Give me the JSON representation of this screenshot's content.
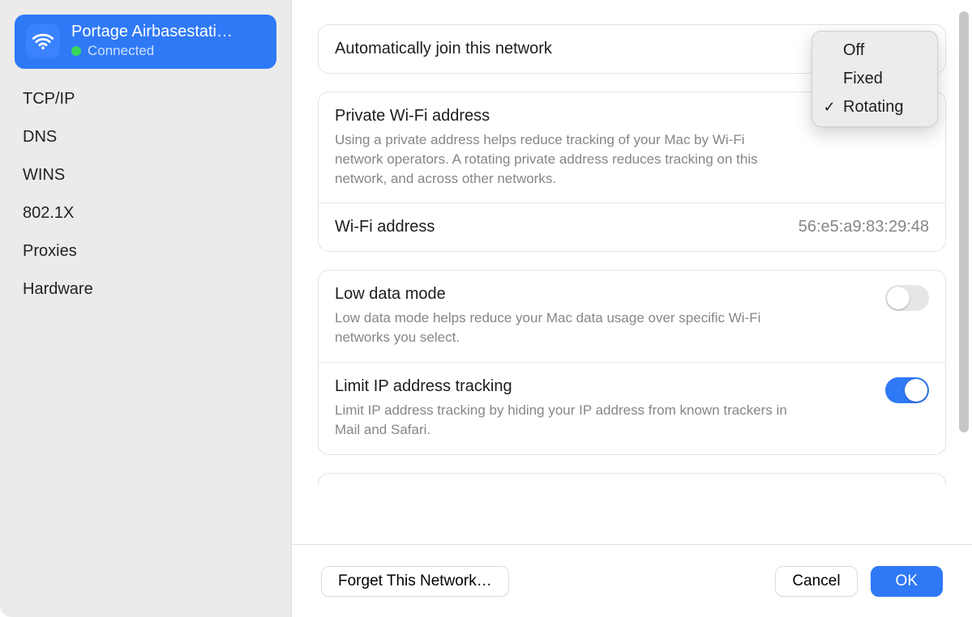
{
  "sidebar": {
    "network": {
      "name": "Portage Airbasestati…",
      "status_label": "Connected"
    },
    "items": [
      {
        "label": "TCP/IP"
      },
      {
        "label": "DNS"
      },
      {
        "label": "WINS"
      },
      {
        "label": "802.1X"
      },
      {
        "label": "Proxies"
      },
      {
        "label": "Hardware"
      }
    ]
  },
  "settings": {
    "auto_join": {
      "title": "Automatically join this network"
    },
    "private_address": {
      "title": "Private Wi-Fi address",
      "desc": "Using a private address helps reduce tracking of your Mac by Wi-Fi network operators. A rotating private address reduces tracking on this network, and across other networks."
    },
    "wifi_address": {
      "title": "Wi-Fi address",
      "value": "56:e5:a9:83:29:48"
    },
    "low_data": {
      "title": "Low data mode",
      "desc": "Low data mode helps reduce your Mac data usage over specific Wi-Fi networks you select.",
      "enabled": false
    },
    "limit_ip": {
      "title": "Limit IP address tracking",
      "desc": "Limit IP address tracking by hiding your IP address from known trackers in Mail and Safari.",
      "enabled": true
    }
  },
  "dropdown": {
    "options": [
      {
        "label": "Off",
        "selected": false
      },
      {
        "label": "Fixed",
        "selected": false
      },
      {
        "label": "Rotating",
        "selected": true
      }
    ]
  },
  "footer": {
    "forget_label": "Forget This Network…",
    "cancel_label": "Cancel",
    "ok_label": "OK"
  }
}
